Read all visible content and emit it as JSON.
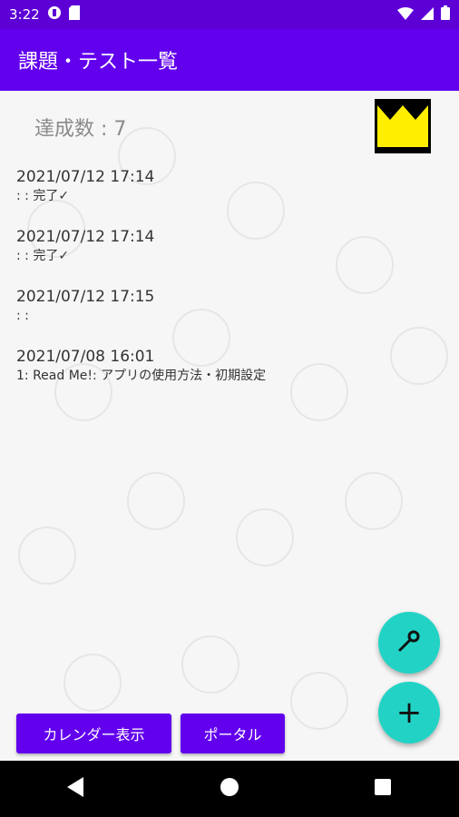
{
  "status_bar": {
    "time": "3:22"
  },
  "app_bar": {
    "title": "課題・テスト一覧"
  },
  "achievement": {
    "label": "達成数 : 7"
  },
  "colors": {
    "primary": "#6200ee",
    "status": "#5c00d6",
    "fab": "#22d3c5",
    "crown": "#ffee00"
  },
  "entries": [
    {
      "date": "2021/07/12 17:14",
      "note": ": :  完了✓"
    },
    {
      "date": "2021/07/12 17:14",
      "note": ": :  完了✓"
    },
    {
      "date": "2021/07/12 17:15",
      "note": ": :"
    },
    {
      "date": "2021/07/08 16:01",
      "note": "1: Read Me!: アプリの使用方法・初期設定"
    }
  ],
  "buttons": {
    "calendar": "カレンダー表示",
    "portal": "ポータル"
  },
  "fabs": {
    "settings_icon": "wrench-icon",
    "add": "+"
  }
}
